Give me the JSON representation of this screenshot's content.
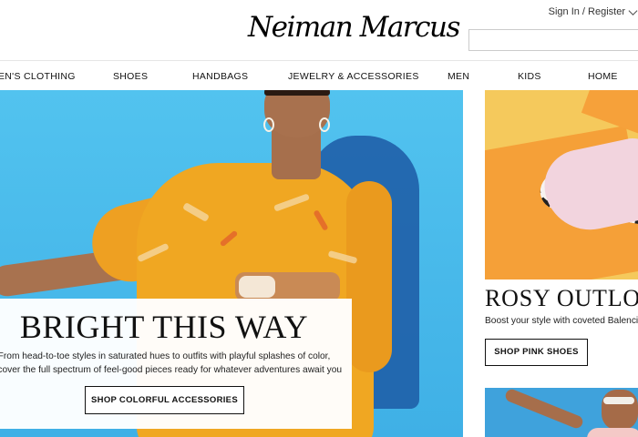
{
  "header": {
    "logo_text": "Neiman Marcus",
    "account_label": "Sign In / Register"
  },
  "nav": {
    "items": [
      "EN'S CLOTHING",
      "SHOES",
      "HANDBAGS",
      "JEWELRY & ACCESSORIES",
      "MEN",
      "KIDS",
      "HOME"
    ]
  },
  "hero": {
    "title": "BRIGHT THIS WAY",
    "body_line1": "From head-to-toe styles in saturated hues to outfits with playful splashes of color,",
    "body_line2": "iscover the full spectrum of feel-good pieces ready for whatever adventures await you",
    "cta_label": "SHOP COLORFUL ACCESSORIES"
  },
  "promo": {
    "title": "ROSY OUTLO",
    "body": "Boost your style with coveted Balenciag",
    "cta_label": "SHOP PINK SHOES"
  },
  "colors": {
    "hero_bg": "#46b8e8",
    "dress": "#f0a722",
    "promo_bg": "#f5c95c"
  }
}
